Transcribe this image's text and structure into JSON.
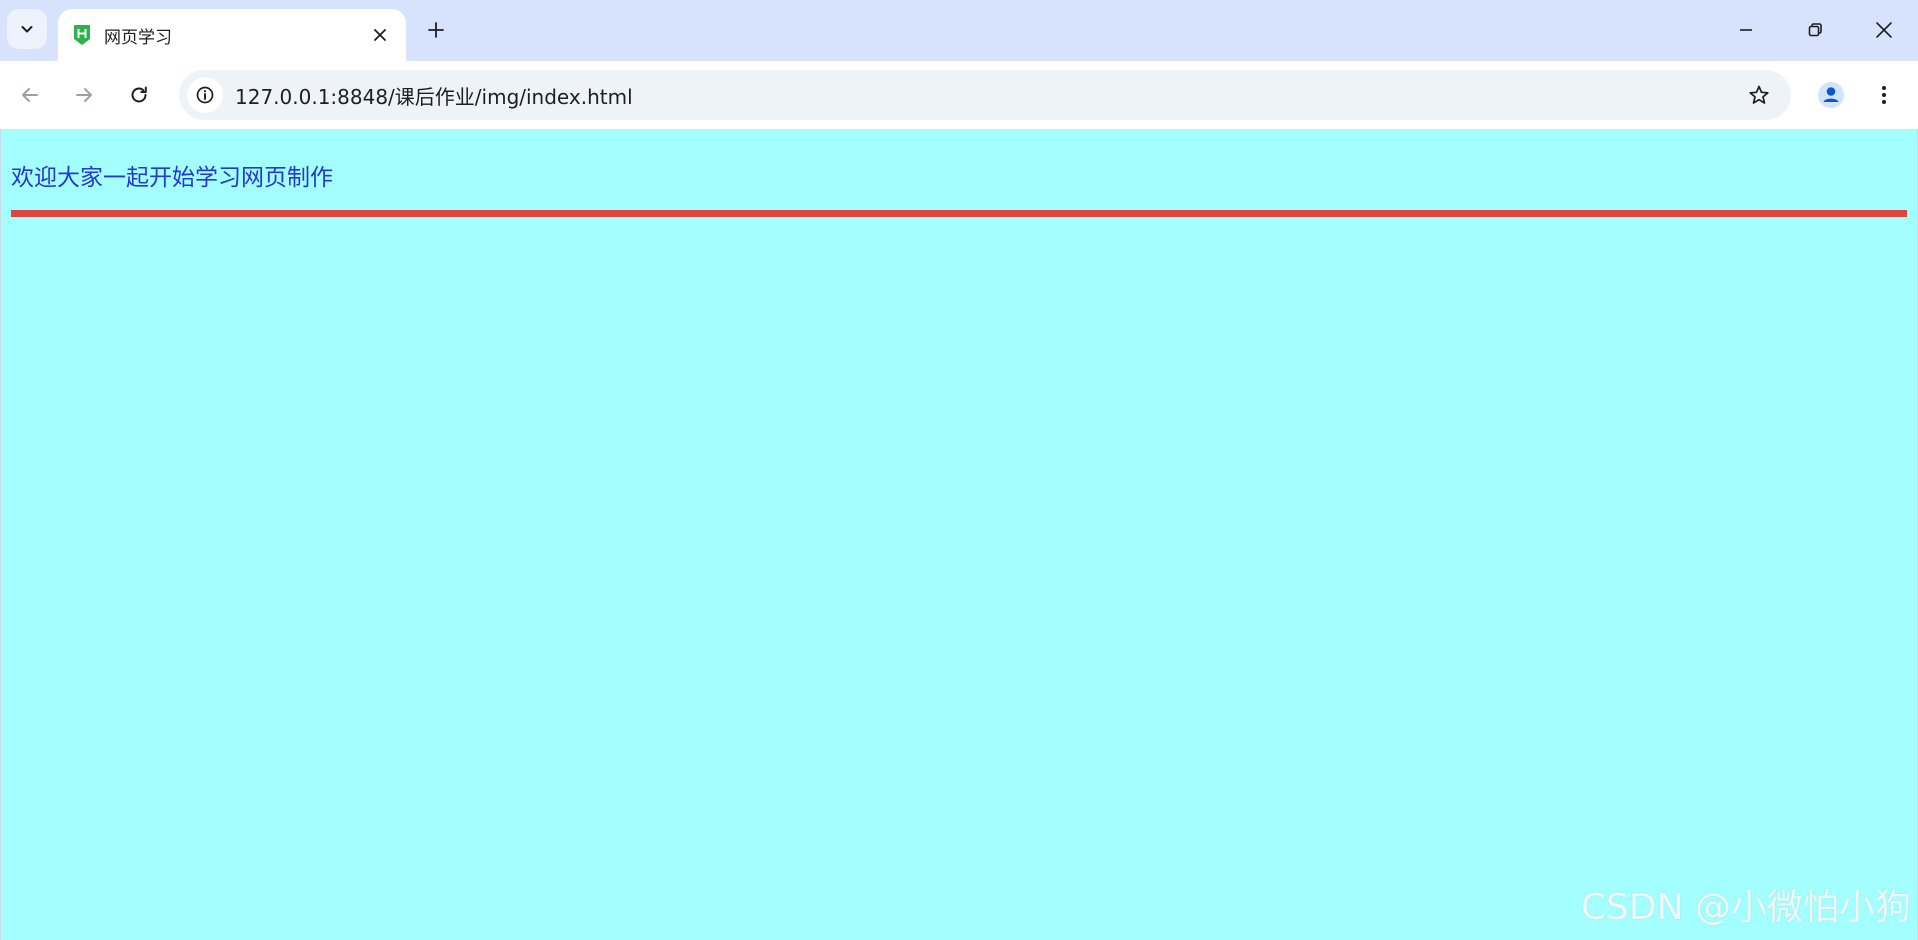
{
  "tab": {
    "title": "网页学习"
  },
  "address_bar": {
    "url": "127.0.0.1:8848/课后作业/img/index.html"
  },
  "page": {
    "heading": "欢迎大家一起开始学习网页制作",
    "background_color": "#a2fffe",
    "text_color": "#2438d9",
    "rule_color": "#e04340"
  },
  "watermark": {
    "text": "CSDN @小微怕小狗"
  },
  "icons": {
    "tab_search": "chevron-down-icon",
    "favicon": "hbuilder-icon",
    "tab_close": "close-icon",
    "new_tab": "plus-icon",
    "minimize": "minimize-icon",
    "restore": "restore-icon",
    "close_window": "close-icon",
    "back": "arrow-left-icon",
    "forward": "arrow-right-icon",
    "reload": "reload-icon",
    "site_info": "info-icon",
    "bookmark": "star-icon",
    "profile": "person-icon",
    "menu": "kebab-menu-icon"
  }
}
